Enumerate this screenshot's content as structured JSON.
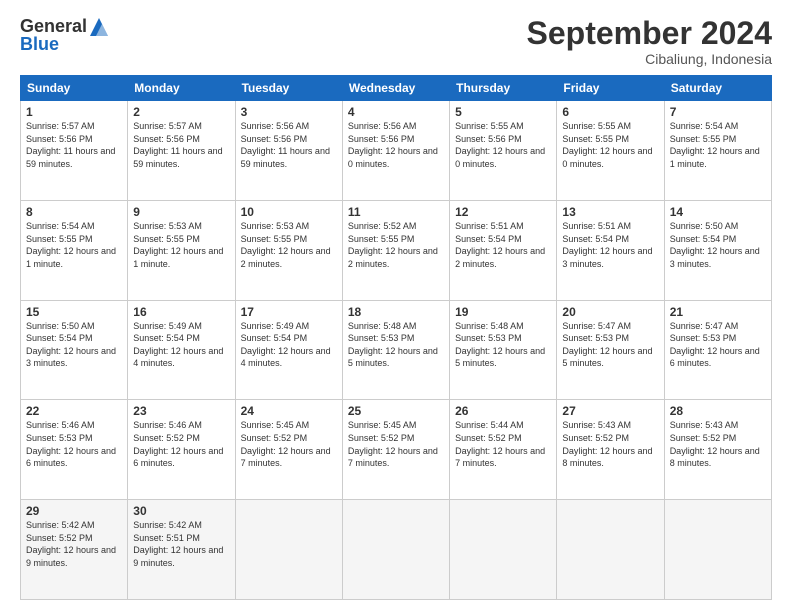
{
  "header": {
    "logo_text1": "General",
    "logo_text2": "Blue",
    "month": "September 2024",
    "location": "Cibaliung, Indonesia"
  },
  "days_of_week": [
    "Sunday",
    "Monday",
    "Tuesday",
    "Wednesday",
    "Thursday",
    "Friday",
    "Saturday"
  ],
  "weeks": [
    [
      {
        "day": "1",
        "info": "Sunrise: 5:57 AM\nSunset: 5:56 PM\nDaylight: 11 hours and 59 minutes."
      },
      {
        "day": "2",
        "info": "Sunrise: 5:57 AM\nSunset: 5:56 PM\nDaylight: 11 hours and 59 minutes."
      },
      {
        "day": "3",
        "info": "Sunrise: 5:56 AM\nSunset: 5:56 PM\nDaylight: 11 hours and 59 minutes."
      },
      {
        "day": "4",
        "info": "Sunrise: 5:56 AM\nSunset: 5:56 PM\nDaylight: 12 hours and 0 minutes."
      },
      {
        "day": "5",
        "info": "Sunrise: 5:55 AM\nSunset: 5:56 PM\nDaylight: 12 hours and 0 minutes."
      },
      {
        "day": "6",
        "info": "Sunrise: 5:55 AM\nSunset: 5:55 PM\nDaylight: 12 hours and 0 minutes."
      },
      {
        "day": "7",
        "info": "Sunrise: 5:54 AM\nSunset: 5:55 PM\nDaylight: 12 hours and 1 minute."
      }
    ],
    [
      {
        "day": "8",
        "info": "Sunrise: 5:54 AM\nSunset: 5:55 PM\nDaylight: 12 hours and 1 minute."
      },
      {
        "day": "9",
        "info": "Sunrise: 5:53 AM\nSunset: 5:55 PM\nDaylight: 12 hours and 1 minute."
      },
      {
        "day": "10",
        "info": "Sunrise: 5:53 AM\nSunset: 5:55 PM\nDaylight: 12 hours and 2 minutes."
      },
      {
        "day": "11",
        "info": "Sunrise: 5:52 AM\nSunset: 5:55 PM\nDaylight: 12 hours and 2 minutes."
      },
      {
        "day": "12",
        "info": "Sunrise: 5:51 AM\nSunset: 5:54 PM\nDaylight: 12 hours and 2 minutes."
      },
      {
        "day": "13",
        "info": "Sunrise: 5:51 AM\nSunset: 5:54 PM\nDaylight: 12 hours and 3 minutes."
      },
      {
        "day": "14",
        "info": "Sunrise: 5:50 AM\nSunset: 5:54 PM\nDaylight: 12 hours and 3 minutes."
      }
    ],
    [
      {
        "day": "15",
        "info": "Sunrise: 5:50 AM\nSunset: 5:54 PM\nDaylight: 12 hours and 3 minutes."
      },
      {
        "day": "16",
        "info": "Sunrise: 5:49 AM\nSunset: 5:54 PM\nDaylight: 12 hours and 4 minutes."
      },
      {
        "day": "17",
        "info": "Sunrise: 5:49 AM\nSunset: 5:54 PM\nDaylight: 12 hours and 4 minutes."
      },
      {
        "day": "18",
        "info": "Sunrise: 5:48 AM\nSunset: 5:53 PM\nDaylight: 12 hours and 5 minutes."
      },
      {
        "day": "19",
        "info": "Sunrise: 5:48 AM\nSunset: 5:53 PM\nDaylight: 12 hours and 5 minutes."
      },
      {
        "day": "20",
        "info": "Sunrise: 5:47 AM\nSunset: 5:53 PM\nDaylight: 12 hours and 5 minutes."
      },
      {
        "day": "21",
        "info": "Sunrise: 5:47 AM\nSunset: 5:53 PM\nDaylight: 12 hours and 6 minutes."
      }
    ],
    [
      {
        "day": "22",
        "info": "Sunrise: 5:46 AM\nSunset: 5:53 PM\nDaylight: 12 hours and 6 minutes."
      },
      {
        "day": "23",
        "info": "Sunrise: 5:46 AM\nSunset: 5:52 PM\nDaylight: 12 hours and 6 minutes."
      },
      {
        "day": "24",
        "info": "Sunrise: 5:45 AM\nSunset: 5:52 PM\nDaylight: 12 hours and 7 minutes."
      },
      {
        "day": "25",
        "info": "Sunrise: 5:45 AM\nSunset: 5:52 PM\nDaylight: 12 hours and 7 minutes."
      },
      {
        "day": "26",
        "info": "Sunrise: 5:44 AM\nSunset: 5:52 PM\nDaylight: 12 hours and 7 minutes."
      },
      {
        "day": "27",
        "info": "Sunrise: 5:43 AM\nSunset: 5:52 PM\nDaylight: 12 hours and 8 minutes."
      },
      {
        "day": "28",
        "info": "Sunrise: 5:43 AM\nSunset: 5:52 PM\nDaylight: 12 hours and 8 minutes."
      }
    ],
    [
      {
        "day": "29",
        "info": "Sunrise: 5:42 AM\nSunset: 5:52 PM\nDaylight: 12 hours and 9 minutes."
      },
      {
        "day": "30",
        "info": "Sunrise: 5:42 AM\nSunset: 5:51 PM\nDaylight: 12 hours and 9 minutes."
      },
      {
        "day": "",
        "info": ""
      },
      {
        "day": "",
        "info": ""
      },
      {
        "day": "",
        "info": ""
      },
      {
        "day": "",
        "info": ""
      },
      {
        "day": "",
        "info": ""
      }
    ]
  ]
}
